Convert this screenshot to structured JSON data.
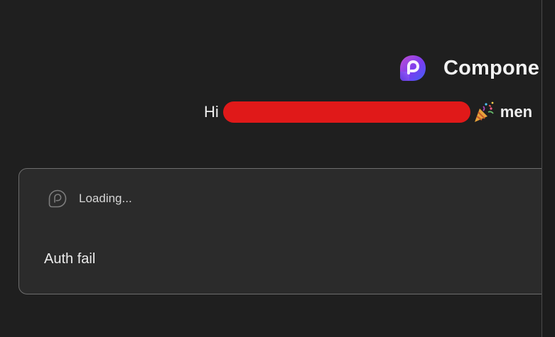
{
  "header": {
    "app_name": "Compone",
    "logo_icon": "loop-logo-icon"
  },
  "greeting": {
    "prefix": "Hi",
    "redacted": true,
    "emoji_icon": "party-popper-icon",
    "suffix": "men"
  },
  "card": {
    "loading_icon": "loop-outline-icon",
    "loading_label": "Loading...",
    "message": "Auth fail"
  },
  "colors": {
    "background": "#1f1f1f",
    "card_background": "#2b2b2b",
    "card_border": "#6e6e6e",
    "redaction": "#e01919",
    "logo_gradient_start": "#7b4dff",
    "logo_gradient_end": "#c43cc4"
  }
}
